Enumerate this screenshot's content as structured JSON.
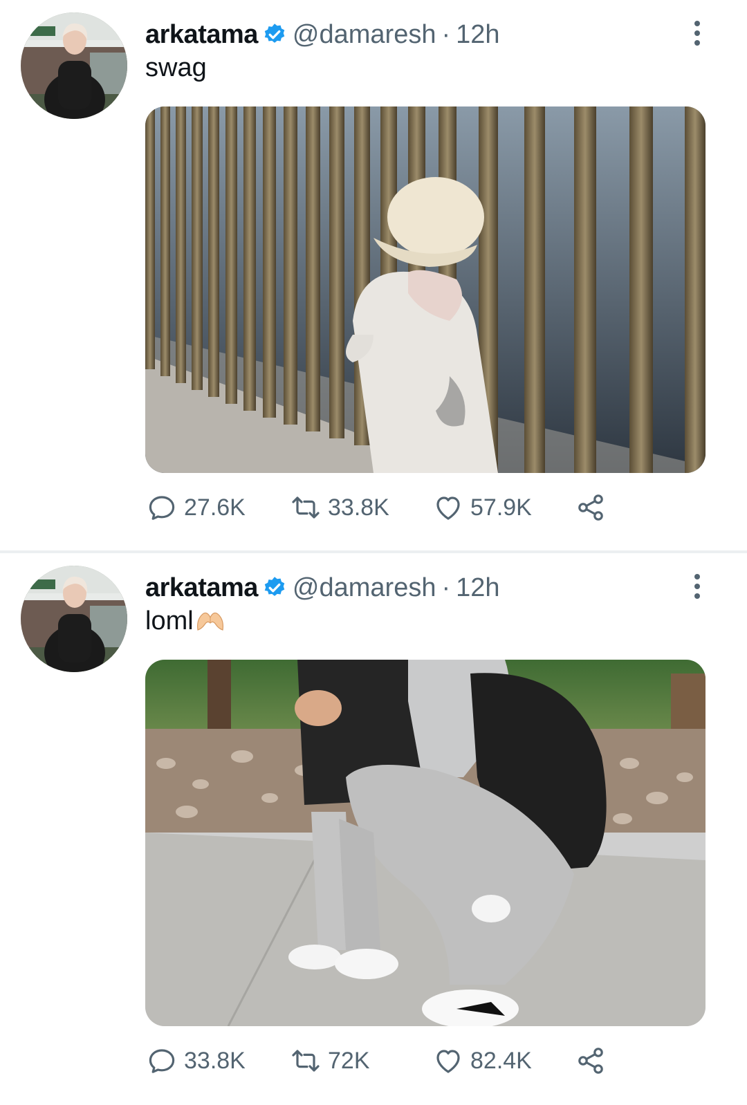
{
  "tweets": [
    {
      "author": {
        "name": "arkatama",
        "handle": "@damaresh",
        "verified": true
      },
      "separator": "·",
      "time": "12h",
      "text": "swag",
      "emoji": "",
      "actions": {
        "replies": "27.6K",
        "retweets": "33.8K",
        "likes": "57.9K"
      }
    },
    {
      "author": {
        "name": "arkatama",
        "handle": "@damaresh",
        "verified": true
      },
      "separator": "·",
      "time": "12h",
      "text": "loml",
      "emoji": "heart-hands",
      "actions": {
        "replies": "33.8K",
        "retweets": "72K",
        "likes": "82.4K"
      }
    }
  ],
  "colors": {
    "verified": "#1d9bf0",
    "secondary_text": "#536471",
    "primary_text": "#0f1419",
    "divider": "#eceff1"
  },
  "icons": {
    "reply": "reply-icon",
    "retweet": "retweet-icon",
    "like": "like-icon",
    "share": "share-icon",
    "more": "more-vertical-icon",
    "verified": "verified-badge-icon"
  }
}
